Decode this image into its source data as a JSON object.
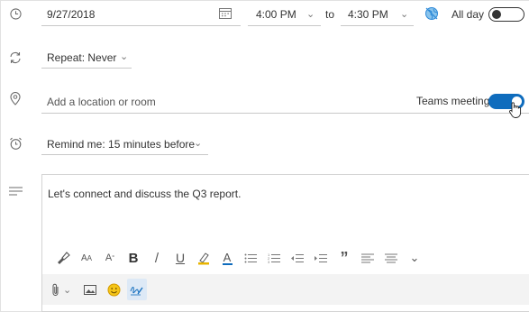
{
  "row_date": {
    "date_value": "9/27/2018",
    "start_time": "4:00 PM",
    "to_label": "to",
    "end_time": "4:30 PM",
    "allday_label": "All day",
    "allday_on": false
  },
  "row_repeat": {
    "repeat_label": "Repeat: Never"
  },
  "row_location": {
    "placeholder": "Add a location or room",
    "teams_label": "Teams meeting",
    "teams_on": true
  },
  "row_remind": {
    "remind_label": "Remind me: 15 minutes before"
  },
  "body": {
    "text": "Let's connect and discuss the Q3 report."
  },
  "colors": {
    "accent": "#0f6cbd",
    "highlight_marker": "#e8b400",
    "font_color": "#0f6cbd",
    "emoji": "#f5c518"
  },
  "toolbar": {
    "font_size_decrease": "A",
    "font_size_increase": "A",
    "bold": "B",
    "italic": "/",
    "underline": "U",
    "font_color": "A",
    "quote": "”"
  }
}
